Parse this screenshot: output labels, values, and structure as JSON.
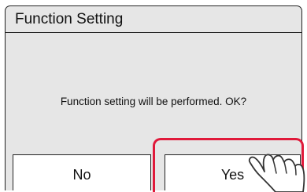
{
  "dialog": {
    "title": "Function Setting",
    "message": "Function setting will be performed. OK?"
  },
  "buttons": {
    "no_label": "No",
    "yes_label": "Yes"
  },
  "colors": {
    "highlight": "#e0193a",
    "screen_bg": "#e6e6e6",
    "button_bg": "#ffffff"
  },
  "icons": {
    "pointer": "tapping-hand-icon"
  }
}
